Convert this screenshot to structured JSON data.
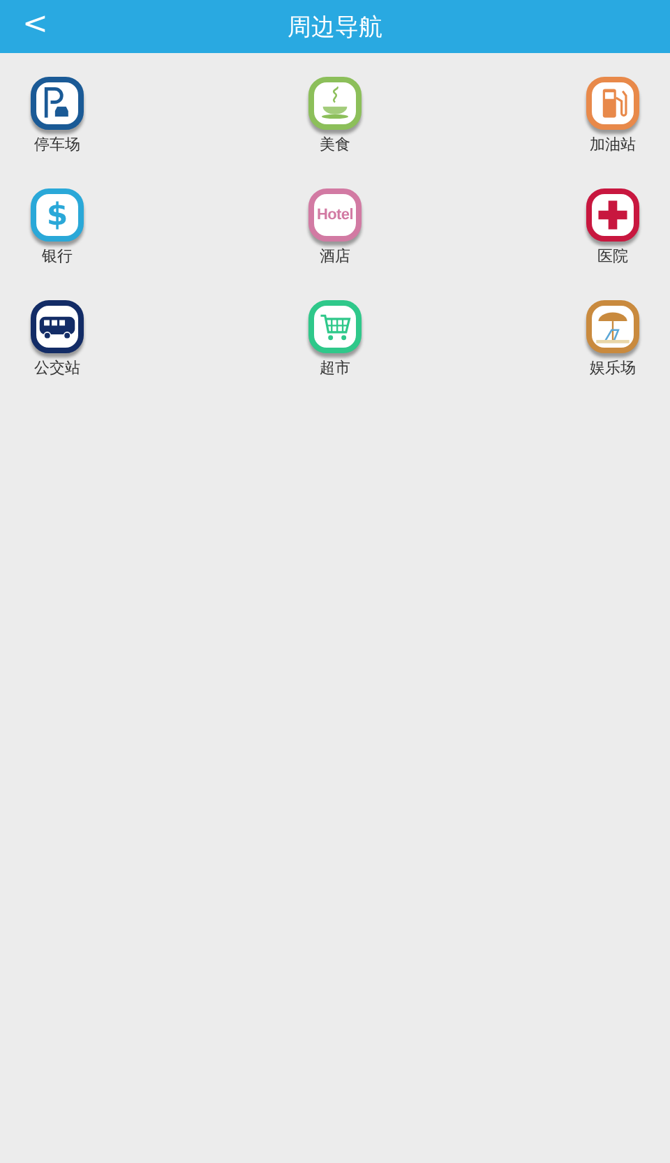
{
  "header": {
    "back_icon": "<",
    "title": "周边导航"
  },
  "places": [
    {
      "label": "停车场",
      "kind": "parking",
      "color": "#1a5a96"
    },
    {
      "label": "美食",
      "kind": "food",
      "color": "#8cbf5a"
    },
    {
      "label": "加油站",
      "kind": "fuel",
      "color": "#e8894a"
    },
    {
      "label": "银行",
      "kind": "bank",
      "color": "#2aa8d8",
      "glyph": "$"
    },
    {
      "label": "酒店",
      "kind": "hotel",
      "color": "#d27aa3",
      "glyph": "Hotel"
    },
    {
      "label": "医院",
      "kind": "hospital",
      "color": "#c8173f"
    },
    {
      "label": "公交站",
      "kind": "bus",
      "color": "#132c66"
    },
    {
      "label": "超市",
      "kind": "market",
      "color": "#2fc88a"
    },
    {
      "label": "娱乐场",
      "kind": "leisure",
      "color": "#c98a3e"
    }
  ]
}
